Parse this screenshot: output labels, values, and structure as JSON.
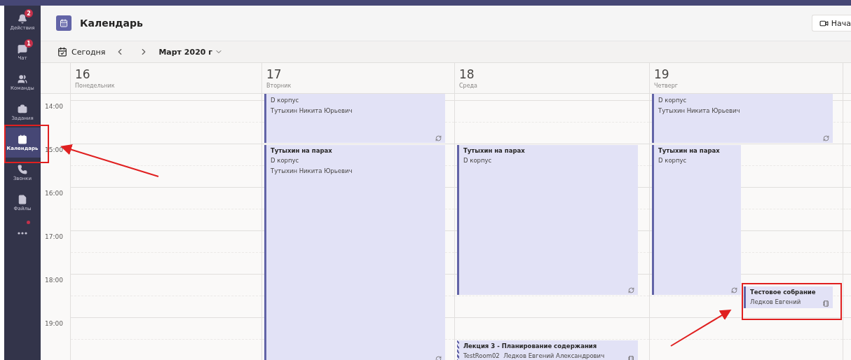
{
  "app_bar": {
    "items": [
      {
        "label": "Действия",
        "badge": "2",
        "selected": false
      },
      {
        "label": "Чат",
        "badge": "1",
        "selected": false
      },
      {
        "label": "Команды",
        "selected": false
      },
      {
        "label": "Задания",
        "selected": false
      },
      {
        "label": "Календарь",
        "selected": true
      },
      {
        "label": "Звонки",
        "selected": false
      },
      {
        "label": "Файлы",
        "selected": false
      },
      {
        "kind": "more",
        "notification_dot": true,
        "selected": false
      }
    ]
  },
  "header": {
    "title": "Календарь",
    "button": "Нача"
  },
  "toolbar": {
    "today": "Сегодня",
    "month": "Март 2020 г"
  },
  "time_labels": [
    "14:00",
    "15:00",
    "16:00",
    "17:00",
    "18:00",
    "19:00"
  ],
  "days": [
    {
      "number": "16",
      "weekday": "Понедельник"
    },
    {
      "number": "17",
      "weekday": "Вторник",
      "events": [
        {
          "kind": "recurring",
          "lines": [
            "D корпус",
            "Тутыхин Никита Юрьевич"
          ]
        },
        {
          "kind": "recurring",
          "title": "Тутыхин на парах",
          "lines": [
            "D корпус",
            "Тутыхин Никита Юрьевич"
          ]
        }
      ]
    },
    {
      "number": "18",
      "weekday": "Среда",
      "events": [
        {
          "kind": "recurring",
          "title": "Тутыхин на парах",
          "lines": [
            "D корпус"
          ]
        },
        {
          "kind": "meeting",
          "tentative": true,
          "title": "Лекция 3 - Планирование содержания",
          "lines": [
            "TestRoom02  Ледков Евгений Александрович"
          ]
        }
      ]
    },
    {
      "number": "19",
      "weekday": "Четверг",
      "events": [
        {
          "kind": "recurring",
          "lines": [
            "D корпус",
            "Тутыхин Никита Юрьевич"
          ]
        },
        {
          "kind": "recurring",
          "title": "Тутыхин на парах",
          "lines": [
            "D корпус"
          ]
        },
        {
          "kind": "meeting",
          "title": "Тестовое собрание",
          "lines": [
            "Ледков Евгений"
          ]
        }
      ]
    }
  ]
}
